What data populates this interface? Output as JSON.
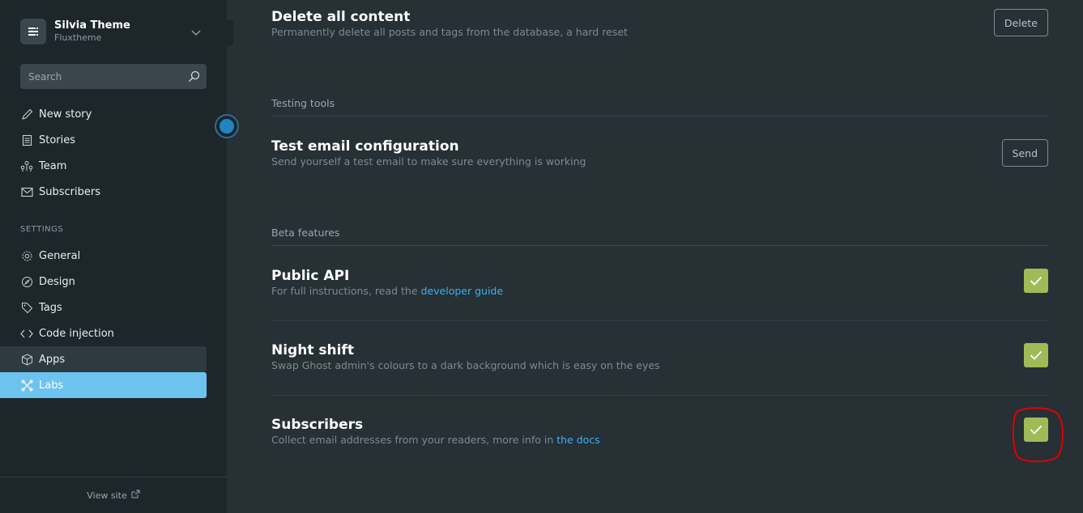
{
  "brand": {
    "title": "Silvia Theme",
    "subtitle": "Fluxtheme"
  },
  "search": {
    "placeholder": "Search"
  },
  "nav": [
    {
      "label": "New story",
      "icon": "pencil-icon"
    },
    {
      "label": "Stories",
      "icon": "document-icon"
    },
    {
      "label": "Team",
      "icon": "team-icon"
    },
    {
      "label": "Subscribers",
      "icon": "mail-icon"
    }
  ],
  "settings_heading": "SETTINGS",
  "settings_nav": [
    {
      "label": "General",
      "icon": "gear-icon"
    },
    {
      "label": "Design",
      "icon": "compass-icon"
    },
    {
      "label": "Tags",
      "icon": "tag-icon"
    },
    {
      "label": "Code injection",
      "icon": "code-icon"
    },
    {
      "label": "Apps",
      "icon": "box-icon"
    },
    {
      "label": "Labs",
      "icon": "labs-icon"
    }
  ],
  "footer": {
    "view_site": "View site"
  },
  "main": {
    "delete": {
      "title": "Delete all content",
      "desc": "Permanently delete all posts and tags from the database, a hard reset",
      "button": "Delete"
    },
    "testing_heading": "Testing tools",
    "test_email": {
      "title": "Test email configuration",
      "desc": "Send yourself a test email to make sure everything is working",
      "button": "Send"
    },
    "beta_heading": "Beta features",
    "public_api": {
      "title": "Public API",
      "desc_prefix": "For full instructions, read the ",
      "link": "developer guide",
      "checked": true
    },
    "night_shift": {
      "title": "Night shift",
      "desc": "Swap Ghost admin's colours to a dark background which is easy on the eyes",
      "checked": true
    },
    "subscribers": {
      "title": "Subscribers",
      "desc_prefix": "Collect email addresses from your readers, more info in ",
      "link": "the docs",
      "checked": true
    }
  },
  "colors": {
    "accent": "#6cc3f0",
    "check": "#9fbb58",
    "link": "#3eb0ef",
    "annotation": "#e00000"
  }
}
